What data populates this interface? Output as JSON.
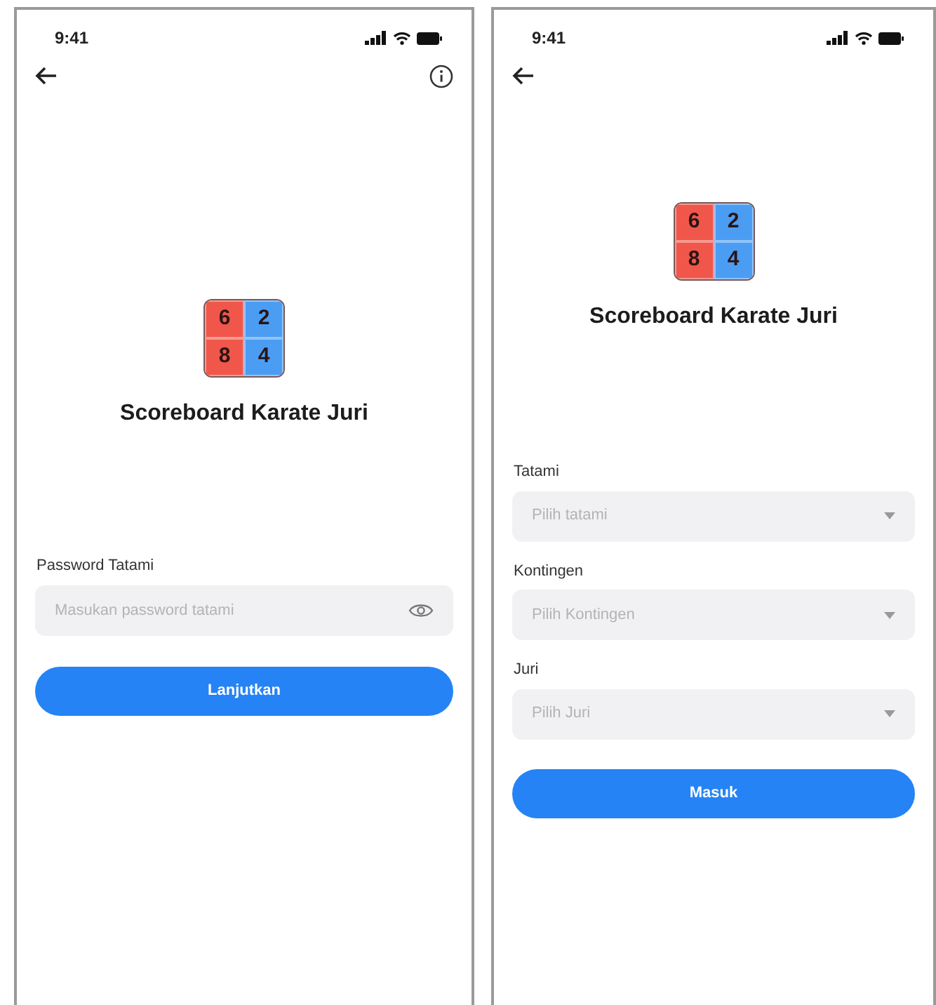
{
  "screens": [
    {
      "kind": "password",
      "time": "9:41",
      "logo": [
        {
          "digit": "6",
          "color": "#f0574a"
        },
        {
          "digit": "2",
          "color": "#4b9df4"
        },
        {
          "digit": "8",
          "color": "#f0574a"
        },
        {
          "digit": "4",
          "color": "#4b9df4"
        }
      ],
      "title": "Scoreboard Karate Juri",
      "fields": [
        {
          "kind": "password",
          "label": "Password Tatami",
          "placeholder": "Masukan password tatami"
        }
      ],
      "button": "Lanjutkan"
    },
    {
      "kind": "select",
      "time": "9:41",
      "logo": [
        {
          "digit": "6",
          "color": "#f0574a"
        },
        {
          "digit": "2",
          "color": "#4b9df4"
        },
        {
          "digit": "8",
          "color": "#f0574a"
        },
        {
          "digit": "4",
          "color": "#4b9df4"
        }
      ],
      "title": "Scoreboard Karate Juri",
      "fields": [
        {
          "kind": "select",
          "label": "Tatami",
          "placeholder": "Pilih tatami"
        },
        {
          "kind": "select",
          "label": "Kontingen",
          "placeholder": "Pilih Kontingen"
        },
        {
          "kind": "select",
          "label": "Juri",
          "placeholder": "Pilih Juri"
        }
      ],
      "button": "Masuk"
    }
  ]
}
